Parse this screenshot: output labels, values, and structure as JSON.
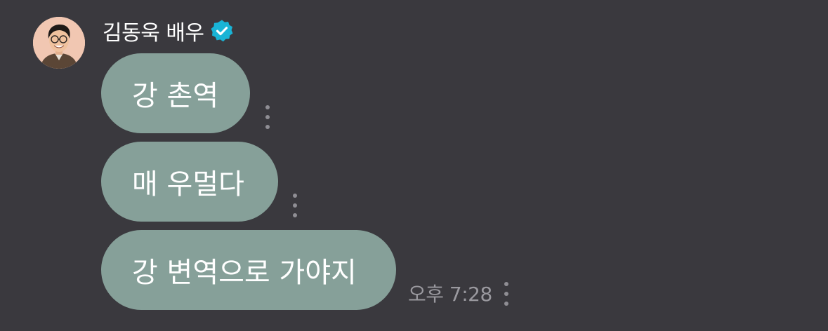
{
  "sender": {
    "name": "김동욱 배우",
    "verified": true,
    "avatar_icon": "profile-photo-man-glasses"
  },
  "messages": [
    {
      "text": "강 촌역"
    },
    {
      "text": "매 우멀다"
    },
    {
      "text": "강 변역으로 가야지",
      "time": "오후 7:28"
    }
  ],
  "colors": {
    "background": "#3a393e",
    "bubble": "#86a099",
    "verified_badge": "#19b4d6",
    "timestamp": "#9a999f"
  }
}
